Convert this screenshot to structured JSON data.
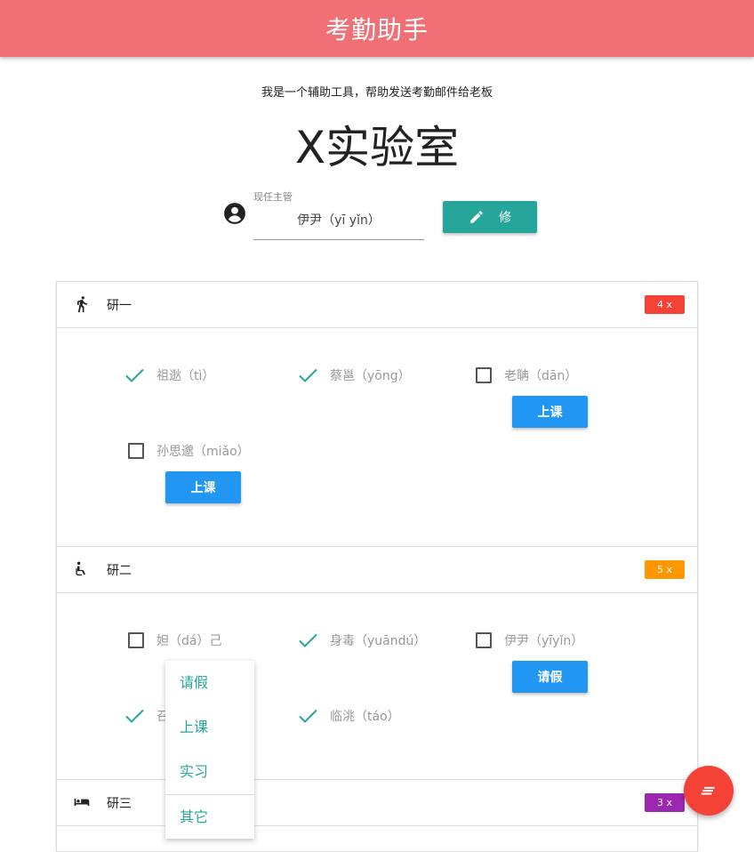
{
  "app": {
    "title": "考勤助手"
  },
  "header": {
    "subtitle": "我是一个辅助工具，帮助发送考勤邮件给老板",
    "lab_name": "X实验室"
  },
  "supervisor": {
    "label": "现任主管",
    "value": "伊尹（yī yǐn）",
    "edit_label": "修"
  },
  "sections": [
    {
      "name": "研一",
      "badge": "4 x",
      "badge_color": "#f44336",
      "icon": "running-person-icon",
      "members": [
        {
          "name": "祖逖（tì）",
          "checked": true
        },
        {
          "name": "蔡邕（yōng）",
          "checked": true
        },
        {
          "name": "老聃（dān）",
          "checked": false,
          "status": "上课"
        },
        {
          "name": "孙思邈（miǎo）",
          "checked": false,
          "status": "上课"
        }
      ]
    },
    {
      "name": "研二",
      "badge": "5 x",
      "badge_color": "#ff9800",
      "icon": "wheelchair-icon",
      "members": [
        {
          "name": "妲（dá）己",
          "checked": false
        },
        {
          "name": "身毒（yuāndú）",
          "checked": true
        },
        {
          "name": "伊尹（yīyǐn）",
          "checked": false,
          "status": "请假"
        },
        {
          "name": "召",
          "checked": true
        },
        {
          "name": "临洮（táo）",
          "checked": true
        }
      ]
    },
    {
      "name": "研三",
      "badge": "3 x",
      "badge_color": "#9c27b0",
      "icon": "bed-icon"
    }
  ],
  "dropdown": {
    "options": [
      "请假",
      "上课",
      "实习",
      "其它"
    ]
  },
  "colors": {
    "appbar": "#f07075",
    "teal": "#26a69a",
    "blue": "#2196f3",
    "fab": "#f44336"
  }
}
